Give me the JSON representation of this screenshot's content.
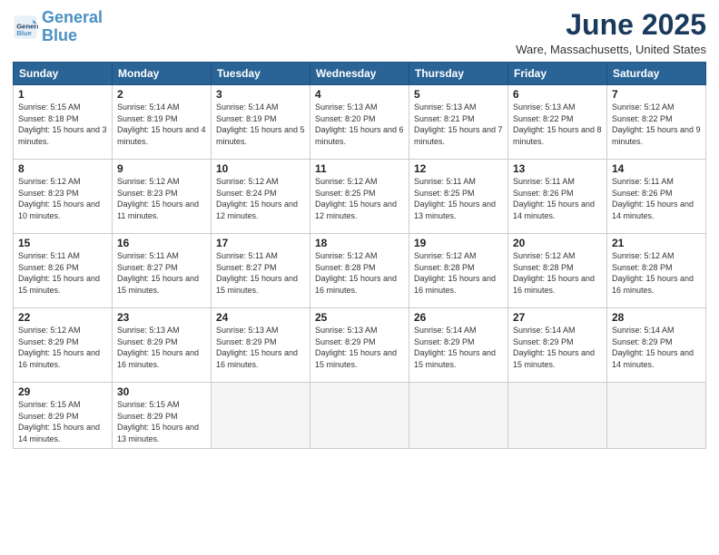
{
  "header": {
    "logo_line1": "General",
    "logo_line2": "Blue",
    "month": "June 2025",
    "location": "Ware, Massachusetts, United States"
  },
  "weekdays": [
    "Sunday",
    "Monday",
    "Tuesday",
    "Wednesday",
    "Thursday",
    "Friday",
    "Saturday"
  ],
  "weeks": [
    [
      {
        "day": "1",
        "sunrise": "5:15 AM",
        "sunset": "8:18 PM",
        "daylight": "15 hours and 3 minutes."
      },
      {
        "day": "2",
        "sunrise": "5:14 AM",
        "sunset": "8:19 PM",
        "daylight": "15 hours and 4 minutes."
      },
      {
        "day": "3",
        "sunrise": "5:14 AM",
        "sunset": "8:19 PM",
        "daylight": "15 hours and 5 minutes."
      },
      {
        "day": "4",
        "sunrise": "5:13 AM",
        "sunset": "8:20 PM",
        "daylight": "15 hours and 6 minutes."
      },
      {
        "day": "5",
        "sunrise": "5:13 AM",
        "sunset": "8:21 PM",
        "daylight": "15 hours and 7 minutes."
      },
      {
        "day": "6",
        "sunrise": "5:13 AM",
        "sunset": "8:22 PM",
        "daylight": "15 hours and 8 minutes."
      },
      {
        "day": "7",
        "sunrise": "5:12 AM",
        "sunset": "8:22 PM",
        "daylight": "15 hours and 9 minutes."
      }
    ],
    [
      {
        "day": "8",
        "sunrise": "5:12 AM",
        "sunset": "8:23 PM",
        "daylight": "15 hours and 10 minutes."
      },
      {
        "day": "9",
        "sunrise": "5:12 AM",
        "sunset": "8:23 PM",
        "daylight": "15 hours and 11 minutes."
      },
      {
        "day": "10",
        "sunrise": "5:12 AM",
        "sunset": "8:24 PM",
        "daylight": "15 hours and 12 minutes."
      },
      {
        "day": "11",
        "sunrise": "5:12 AM",
        "sunset": "8:25 PM",
        "daylight": "15 hours and 12 minutes."
      },
      {
        "day": "12",
        "sunrise": "5:11 AM",
        "sunset": "8:25 PM",
        "daylight": "15 hours and 13 minutes."
      },
      {
        "day": "13",
        "sunrise": "5:11 AM",
        "sunset": "8:26 PM",
        "daylight": "15 hours and 14 minutes."
      },
      {
        "day": "14",
        "sunrise": "5:11 AM",
        "sunset": "8:26 PM",
        "daylight": "15 hours and 14 minutes."
      }
    ],
    [
      {
        "day": "15",
        "sunrise": "5:11 AM",
        "sunset": "8:26 PM",
        "daylight": "15 hours and 15 minutes."
      },
      {
        "day": "16",
        "sunrise": "5:11 AM",
        "sunset": "8:27 PM",
        "daylight": "15 hours and 15 minutes."
      },
      {
        "day": "17",
        "sunrise": "5:11 AM",
        "sunset": "8:27 PM",
        "daylight": "15 hours and 15 minutes."
      },
      {
        "day": "18",
        "sunrise": "5:12 AM",
        "sunset": "8:28 PM",
        "daylight": "15 hours and 16 minutes."
      },
      {
        "day": "19",
        "sunrise": "5:12 AM",
        "sunset": "8:28 PM",
        "daylight": "15 hours and 16 minutes."
      },
      {
        "day": "20",
        "sunrise": "5:12 AM",
        "sunset": "8:28 PM",
        "daylight": "15 hours and 16 minutes."
      },
      {
        "day": "21",
        "sunrise": "5:12 AM",
        "sunset": "8:28 PM",
        "daylight": "15 hours and 16 minutes."
      }
    ],
    [
      {
        "day": "22",
        "sunrise": "5:12 AM",
        "sunset": "8:29 PM",
        "daylight": "15 hours and 16 minutes."
      },
      {
        "day": "23",
        "sunrise": "5:13 AM",
        "sunset": "8:29 PM",
        "daylight": "15 hours and 16 minutes."
      },
      {
        "day": "24",
        "sunrise": "5:13 AM",
        "sunset": "8:29 PM",
        "daylight": "15 hours and 16 minutes."
      },
      {
        "day": "25",
        "sunrise": "5:13 AM",
        "sunset": "8:29 PM",
        "daylight": "15 hours and 15 minutes."
      },
      {
        "day": "26",
        "sunrise": "5:14 AM",
        "sunset": "8:29 PM",
        "daylight": "15 hours and 15 minutes."
      },
      {
        "day": "27",
        "sunrise": "5:14 AM",
        "sunset": "8:29 PM",
        "daylight": "15 hours and 15 minutes."
      },
      {
        "day": "28",
        "sunrise": "5:14 AM",
        "sunset": "8:29 PM",
        "daylight": "15 hours and 14 minutes."
      }
    ],
    [
      {
        "day": "29",
        "sunrise": "5:15 AM",
        "sunset": "8:29 PM",
        "daylight": "15 hours and 14 minutes."
      },
      {
        "day": "30",
        "sunrise": "5:15 AM",
        "sunset": "8:29 PM",
        "daylight": "15 hours and 13 minutes."
      },
      null,
      null,
      null,
      null,
      null
    ]
  ]
}
